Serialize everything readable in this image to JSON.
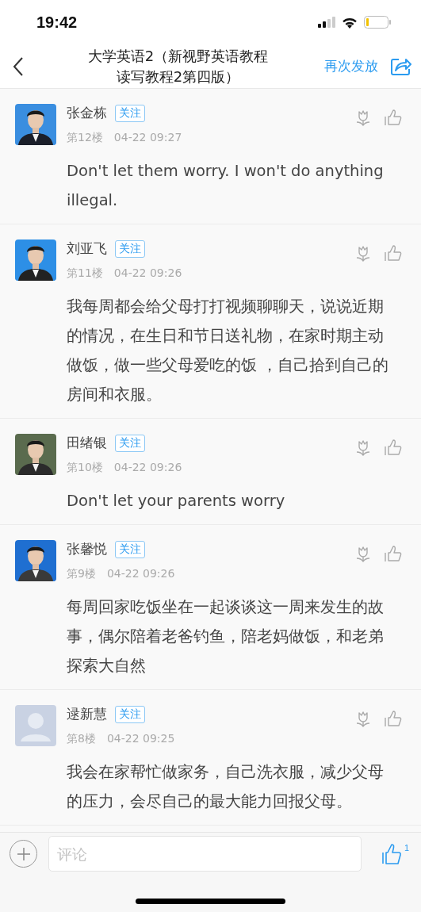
{
  "status_bar": {
    "time": "19:42"
  },
  "header": {
    "title_lines": [
      "大学英语2（新视野英语教程",
      "读写教程2第四版）"
    ],
    "action": "再次发放"
  },
  "comments": [
    {
      "name": "张金栋",
      "follow": "关注",
      "floor": "第12楼",
      "time": "04-22 09:27",
      "body": "Don't let them worry. I won't do anything illegal."
    },
    {
      "name": "刘亚飞",
      "follow": "关注",
      "floor": "第11楼",
      "time": "04-22 09:26",
      "body": "我每周都会给父母打打视频聊聊天，说说近期的情况，在生日和节日送礼物，在家时期主动做饭，做一些父母爱吃的饭 ，自己拾到自己的房间和衣服。"
    },
    {
      "name": "田绪银",
      "follow": "关注",
      "floor": "第10楼",
      "time": "04-22 09:26",
      "body": "Don't let your parents worry"
    },
    {
      "name": "张馨悦",
      "follow": "关注",
      "floor": "第9楼",
      "time": "04-22 09:26",
      "body": "每周回家吃饭坐在一起谈谈这一周来发生的故事，偶尔陪着老爸钓鱼，陪老妈做饭，和老弟探索大自然"
    },
    {
      "avatar": {
        "kind": "placeholder"
      },
      "name": "逯新慧",
      "follow": "关注",
      "floor": "第8楼",
      "time": "04-22 09:25",
      "body": "我会在家帮忙做家务，自己洗衣服，减少父母的压力，会尽自己的最大能力回报父母。"
    }
  ],
  "footer": {
    "placeholder": "评论",
    "like_count": "1"
  }
}
